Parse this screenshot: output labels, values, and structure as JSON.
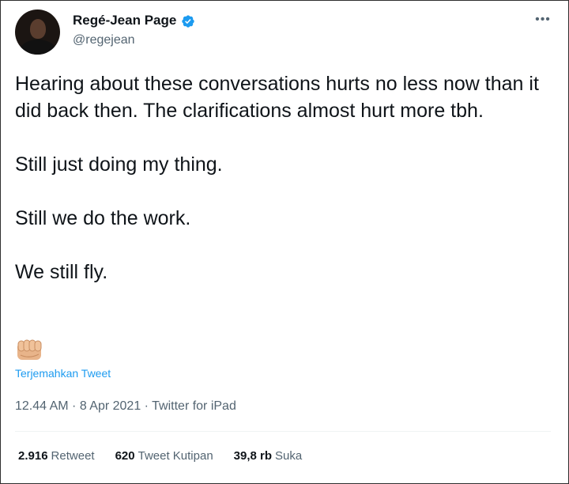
{
  "tweet": {
    "author": {
      "name": "Regé-Jean Page",
      "handle": "@regejean",
      "verified": true
    },
    "paragraphs": [
      "Hearing about these conversations hurts no less now than it did back then. The clarifications almost hurt more tbh.",
      "Still just doing my thing.",
      "Still we do the work.",
      "We still fly."
    ],
    "emoji": "fist-icon",
    "translate_label": "Terjemahkan Tweet",
    "meta": "12.44 AM · 8 Apr 2021 · Twitter for iPad",
    "stats": {
      "retweets_count": "2.916",
      "retweets_label": "Retweet",
      "quotes_count": "620",
      "quotes_label": "Tweet Kutipan",
      "likes_count": "39,8 rb",
      "likes_label": "Suka"
    }
  },
  "colors": {
    "verified_blue": "#1d9bf0",
    "secondary_text": "#536471",
    "primary_text": "#0f1419"
  }
}
